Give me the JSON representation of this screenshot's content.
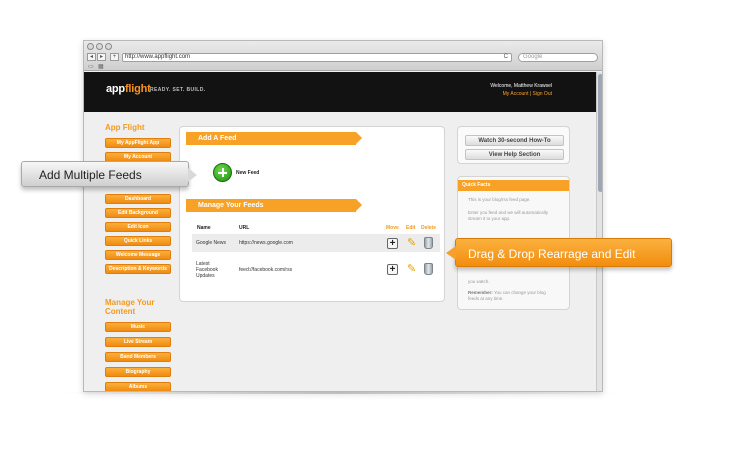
{
  "browser": {
    "url": "http://www.appflight.com",
    "search_placeholder": "Google",
    "back_glyph": "◂",
    "forward_glyph": "▸",
    "add_glyph": "+",
    "reload_glyph": "C"
  },
  "header": {
    "logo_app": "app",
    "logo_flight": "flight",
    "tagline": "READY. SET. BUILD.",
    "welcome": "Welcome, Matthew Krawsel",
    "account_links": "My Account | Sign Out"
  },
  "sidebar": {
    "app_section_title": "App Flight",
    "app_items": [
      "My AppFlight App",
      "My Account",
      "Dashboard",
      "Edit Background",
      "Edit Icon",
      "Quick Links",
      "Welcome Message",
      "Description & Keywords"
    ],
    "content_section_title_1": "Manage Your",
    "content_section_title_2": "Content",
    "content_items": [
      "Music",
      "Live Stream",
      "Band Members",
      "Biography",
      "Albums"
    ]
  },
  "main": {
    "add_feed_title": "Add A Feed",
    "new_feed_label": "New Feed",
    "manage_title": "Manage Your Feeds",
    "columns": {
      "name": "Name",
      "url": "URL",
      "move": "Move",
      "edit": "Edit",
      "delete": "Delete"
    },
    "feeds": [
      {
        "name": "Google News",
        "url": "https://news.google.com"
      },
      {
        "name": "Latest Facebook Updates",
        "url": "feed://facebook.com/rss"
      }
    ]
  },
  "right": {
    "howto_button": "Watch 30-second How-To",
    "help_button": "View Help Section",
    "facts_title": "Quick Facts",
    "fact_1": "This is your blog/rss feed page.",
    "fact_2": "Enter you feed and we will automatically stream it to your app.",
    "fact_3": "you watch.",
    "fact_4_bold": "Remember:",
    "fact_4": "You can change your blog feeds at any time."
  },
  "callouts": {
    "left": "Add Multiple Feeds",
    "right": "Drag & Drop Rearrage and Edit"
  },
  "colors": {
    "accent": "#f7a227",
    "header_bg": "#121212",
    "add_green": "#1d8f14"
  },
  "icons": {
    "move": "move-arrows-icon",
    "edit": "pencil-icon",
    "delete": "trash-icon",
    "add": "plus-circle-icon"
  }
}
